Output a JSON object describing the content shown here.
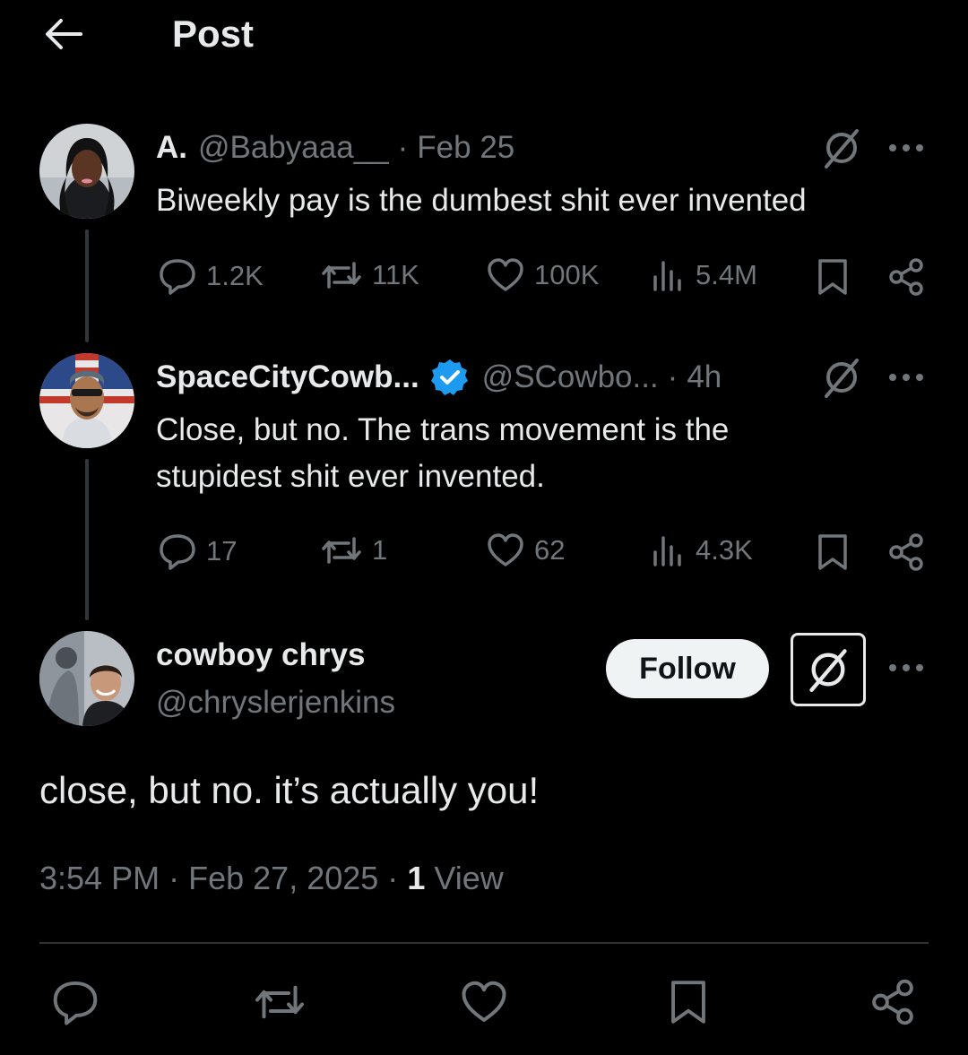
{
  "header": {
    "title": "Post",
    "back_icon": "arrow-left-icon"
  },
  "tweets": [
    {
      "display_name": "A.",
      "handle": "@Babyaaa__",
      "separator": "·",
      "time": "Feb 25",
      "verified": false,
      "text": "Biweekly pay is the dumbest shit ever invented",
      "stats": {
        "replies": "1.2K",
        "reposts": "11K",
        "likes": "100K",
        "views": "5.4M"
      }
    },
    {
      "display_name": "SpaceCityCowb...",
      "handle": "@SCowbo...",
      "separator": "·",
      "time": "4h",
      "verified": true,
      "verified_color": "#1d9bf0",
      "text_line1": "Close, but no. The trans movement is the",
      "text_line2": "stupidest shit ever invented.",
      "stats": {
        "replies": "17",
        "reposts": "1",
        "likes": "62",
        "views": "4.3K"
      }
    }
  ],
  "main_post": {
    "display_name": "cowboy chrys",
    "handle": "@chryslerjenkins",
    "follow_label": "Follow",
    "text": "close, but no. it’s actually you!",
    "time": "3:54 PM",
    "separator": "·",
    "date": "Feb 27, 2025",
    "view_count": "1",
    "view_label": "View"
  },
  "colors": {
    "background": "#000000",
    "text": "#e7e9ea",
    "muted": "#71767b",
    "verified": "#1d9bf0",
    "divider": "#2f3336"
  }
}
